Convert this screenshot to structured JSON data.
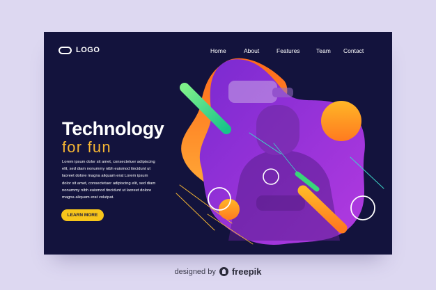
{
  "logo": {
    "text": "LOGO",
    "icon": "pill-icon"
  },
  "nav": {
    "items": [
      {
        "label": "Home"
      },
      {
        "label": "About"
      },
      {
        "label": "Features"
      },
      {
        "label": "Team"
      },
      {
        "label": "Contact"
      }
    ]
  },
  "hero": {
    "title": "Technology",
    "subtitle": "for fun",
    "body_lines": [
      "Lorem ipsum dolor sit amet, consectetuer adipiscing",
      "elit, sed diam nonummy nibh euismod tincidunt ut",
      "laoreet dolore magna aliquam erat  Lorem ipsum",
      "dolor sit amet, consectetuer adipiscing elit, sed diam",
      "nonummy nibh euismod tincidunt ut laoreet dolore",
      "magna aliquam erat volutpat."
    ],
    "cta_label": "LEARN MORE"
  },
  "footer": {
    "text": "designed by",
    "brand": "freepik",
    "icon": "freepik-logo-icon"
  },
  "colors": {
    "page_bg": "#ddd8f1",
    "card_bg": "#13133d",
    "accent_yellow": "#f7b733",
    "button_yellow": "#f7c51b",
    "purple": "#8a2fd6",
    "orange": "#ff8a1c",
    "green": "#39d67a"
  }
}
